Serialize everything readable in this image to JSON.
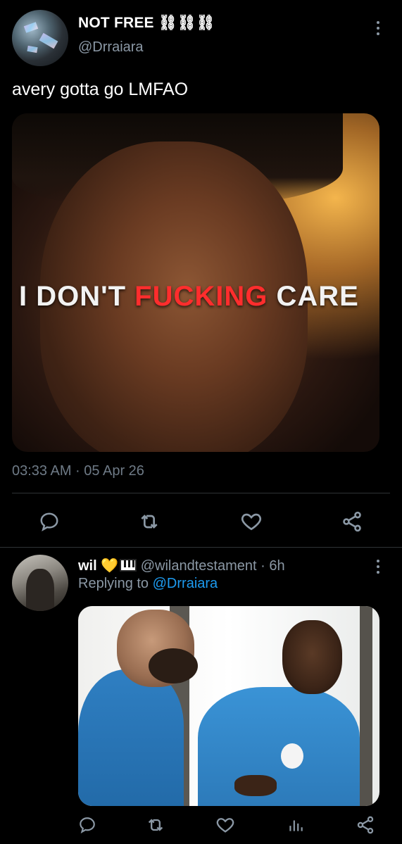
{
  "main_tweet": {
    "display_name": "NOT FREE ⛓⛓⛓",
    "handle": "@Drraiara",
    "text": "avery gotta go LMFAO",
    "media": {
      "caption_part1": "I DON'T ",
      "caption_part2": "FUCKING",
      "caption_part3": " CARE"
    },
    "timestamp": "03:33 AM · 05 Apr 26",
    "actions": [
      "reply-icon",
      "retweet-icon",
      "like-icon",
      "share-icon"
    ]
  },
  "reply_tweet": {
    "display_name": "wil",
    "emoji": "💛",
    "handle": "@wilandtestament",
    "separator": "·",
    "time": "6h",
    "replying_prefix": "Replying to",
    "replying_to": "@Drraiara",
    "actions": [
      "reply-icon",
      "retweet-icon",
      "like-icon",
      "analytics-icon",
      "share-icon"
    ]
  },
  "colors": {
    "background": "#000000",
    "text_primary": "#ffffff",
    "text_secondary": "#8b98a5",
    "link": "#1d9bf0",
    "caption_red": "#ff2d2d",
    "divider": "#2f3336"
  }
}
